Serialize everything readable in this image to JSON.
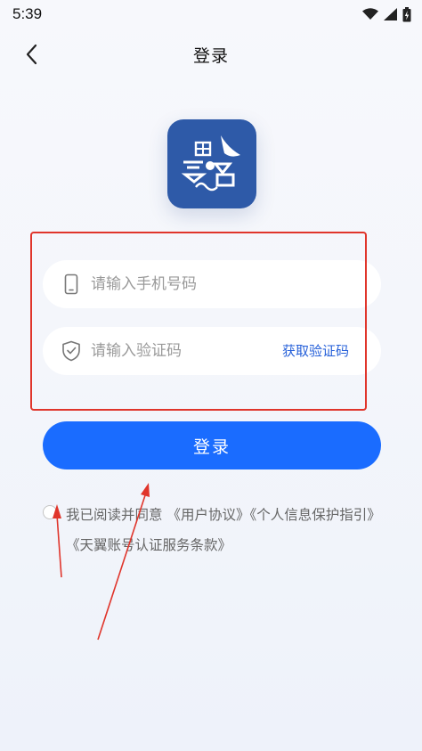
{
  "status_bar": {
    "time": "5:39"
  },
  "nav": {
    "title": "登录",
    "back_icon": "chevron-left-icon"
  },
  "logo": {
    "icon": "app-logo-icon",
    "color": "#2e5aa8"
  },
  "form": {
    "phone_placeholder": "请输入手机号码",
    "phone_icon": "phone-icon",
    "code_placeholder": "请输入验证码",
    "code_icon": "shield-icon",
    "get_code_label": "获取验证码"
  },
  "login_button": {
    "label": "登录",
    "color": "#1a6cff"
  },
  "agreement": {
    "prefix": "我已阅读并同意 ",
    "links": [
      "《用户协议》",
      "《个人信息保护指引》",
      "《天翼账号认证服务条款》"
    ]
  },
  "annotation": {
    "highlight_color": "#e0352b"
  }
}
